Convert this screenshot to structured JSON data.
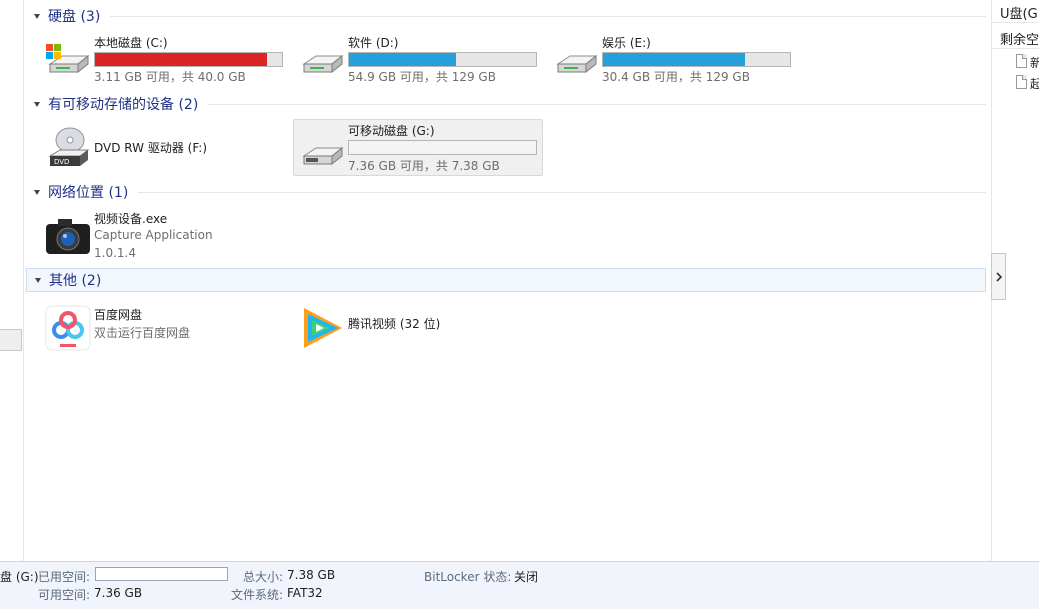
{
  "groups": {
    "hard_disks": {
      "title": "硬盘 (3)",
      "drives": [
        {
          "name": "本地磁盘 (C:)",
          "space": "3.11 GB 可用，共 40.0 GB",
          "used_fraction": 0.92,
          "bar_color": "#da2626",
          "icon": "windows-drive-icon"
        },
        {
          "name": "软件 (D:)",
          "space": "54.9 GB 可用，共 129 GB",
          "used_fraction": 0.57,
          "bar_color": "#26a0da",
          "icon": "hard-drive-icon"
        },
        {
          "name": "娱乐 (E:)",
          "space": "30.4 GB 可用，共 129 GB",
          "used_fraction": 0.76,
          "bar_color": "#26a0da",
          "icon": "hard-drive-icon"
        }
      ]
    },
    "removable": {
      "title": "有可移动存储的设备 (2)",
      "dvd": {
        "name": "DVD RW 驱动器 (F:)",
        "icon": "dvd-drive-icon"
      },
      "usb": {
        "name": "可移动磁盘 (G:)",
        "space": "7.36 GB 可用，共 7.38 GB",
        "used_fraction": 0.0,
        "icon": "removable-drive-icon"
      }
    },
    "network": {
      "title": "网络位置 (1)",
      "item": {
        "name": "视频设备.exe",
        "description": "Capture Application",
        "version": "1.0.1.4",
        "icon": "camera-icon"
      }
    },
    "other": {
      "title": "其他 (2)",
      "items": [
        {
          "name": "百度网盘",
          "description": "双击运行百度网盘",
          "icon": "baidu-netdisk-icon"
        },
        {
          "name": "腾讯视频 (32 位)",
          "icon": "tencent-video-icon"
        }
      ]
    }
  },
  "right_pane": {
    "heading": "U盘(G:",
    "row": "剩余空",
    "files": [
      "新",
      "起"
    ]
  },
  "details": {
    "drive_name": "盘 (G:)",
    "used_label": "已用空间:",
    "used_fraction": 0.0,
    "total_label": "总大小:",
    "total_value": "7.38 GB",
    "bitlocker_label": "BitLocker 状态:",
    "bitlocker_value": "关闭",
    "free_label": "可用空间:",
    "free_value": "7.36 GB",
    "fs_label": "文件系统:",
    "fs_value": "FAT32"
  },
  "colors": {
    "group_title": "#1e3287",
    "bar_red": "#da2626",
    "bar_blue": "#26a0da"
  }
}
